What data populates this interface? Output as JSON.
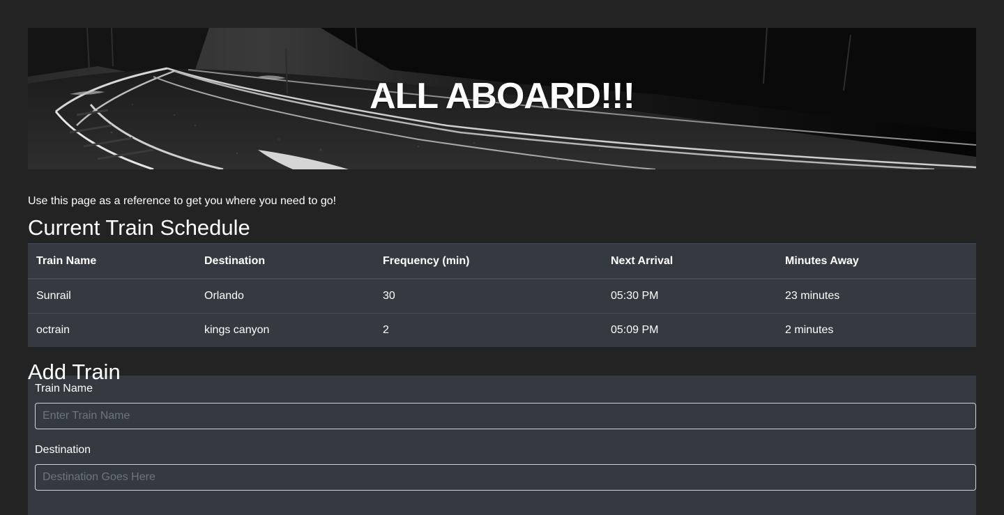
{
  "banner": {
    "heading": "ALL ABOARD!!!"
  },
  "intro_text": "Use this page as a reference to get you where you need to go!",
  "schedule": {
    "title": "Current Train Schedule",
    "columns": [
      "Train Name",
      "Destination",
      "Frequency (min)",
      "Next Arrival",
      "Minutes Away"
    ],
    "rows": [
      [
        "Sunrail",
        "Orlando",
        "30",
        "05:30 PM",
        "23 minutes"
      ],
      [
        "octrain",
        "kings canyon",
        "2",
        "05:09 PM",
        "2 minutes"
      ]
    ]
  },
  "add_train": {
    "title": "Add Train",
    "train_name_label": "Train Name",
    "train_name_placeholder": "Enter Train Name",
    "destination_label": "Destination",
    "destination_placeholder": "Destination Goes Here"
  },
  "colors": {
    "page_background": "#232323",
    "table_background": "#343a40",
    "table_border": "#454d55",
    "text": "#ffffff",
    "placeholder": "#6c757d"
  }
}
